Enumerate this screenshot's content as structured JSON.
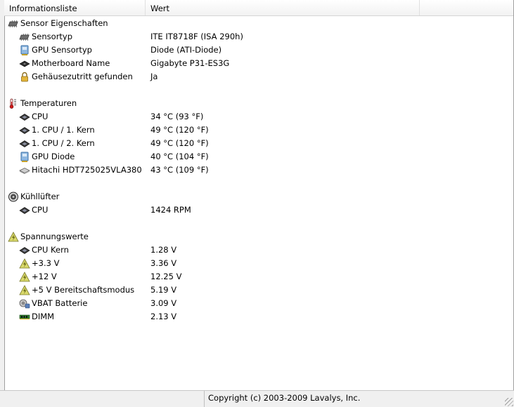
{
  "columns": {
    "info": "Informationsliste",
    "value": "Wert"
  },
  "groups": [
    {
      "label": "Sensor Eigenschaften",
      "icon": "sensor-chip-icon",
      "items": [
        {
          "label": "Sensortyp",
          "value": "ITE IT8718F  (ISA 290h)",
          "icon": "sensor-chip-icon"
        },
        {
          "label": "GPU Sensortyp",
          "value": "Diode  (ATI-Diode)",
          "icon": "gpu-card-icon"
        },
        {
          "label": "Motherboard Name",
          "value": "Gigabyte P31-ES3G",
          "icon": "motherboard-icon"
        },
        {
          "label": "Gehäusezutritt gefunden",
          "value": "Ja",
          "icon": "padlock-icon"
        }
      ]
    },
    {
      "label": "Temperaturen",
      "icon": "thermometer-icon",
      "items": [
        {
          "label": "CPU",
          "value": "34 °C  (93 °F)",
          "icon": "cpu-chip-icon"
        },
        {
          "label": "1. CPU / 1. Kern",
          "value": "49 °C  (120 °F)",
          "icon": "cpu-chip-icon"
        },
        {
          "label": "1. CPU / 2. Kern",
          "value": "49 °C  (120 °F)",
          "icon": "cpu-chip-icon"
        },
        {
          "label": "GPU Diode",
          "value": "40 °C  (104 °F)",
          "icon": "gpu-card-icon"
        },
        {
          "label": "Hitachi HDT725025VLA380",
          "value": "43 °C  (109 °F)",
          "icon": "hard-drive-icon"
        }
      ]
    },
    {
      "label": "Kühllüfter",
      "icon": "fan-icon",
      "items": [
        {
          "label": "CPU",
          "value": "1424 RPM",
          "icon": "cpu-chip-icon"
        }
      ]
    },
    {
      "label": "Spannungswerte",
      "icon": "voltage-warning-icon",
      "items": [
        {
          "label": "CPU Kern",
          "value": "1.28 V",
          "icon": "cpu-chip-icon"
        },
        {
          "label": "+3.3 V",
          "value": "3.36 V",
          "icon": "voltage-warning-icon"
        },
        {
          "label": "+12 V",
          "value": "12.25 V",
          "icon": "voltage-warning-icon"
        },
        {
          "label": "+5 V Bereitschaftsmodus",
          "value": "5.19 V",
          "icon": "voltage-warning-icon"
        },
        {
          "label": "VBAT Batterie",
          "value": "3.09 V",
          "icon": "battery-icon"
        },
        {
          "label": "DIMM",
          "value": "2.13 V",
          "icon": "memory-module-icon"
        }
      ]
    }
  ],
  "status": {
    "copyright": "Copyright (c) 2003-2009 Lavalys, Inc."
  }
}
